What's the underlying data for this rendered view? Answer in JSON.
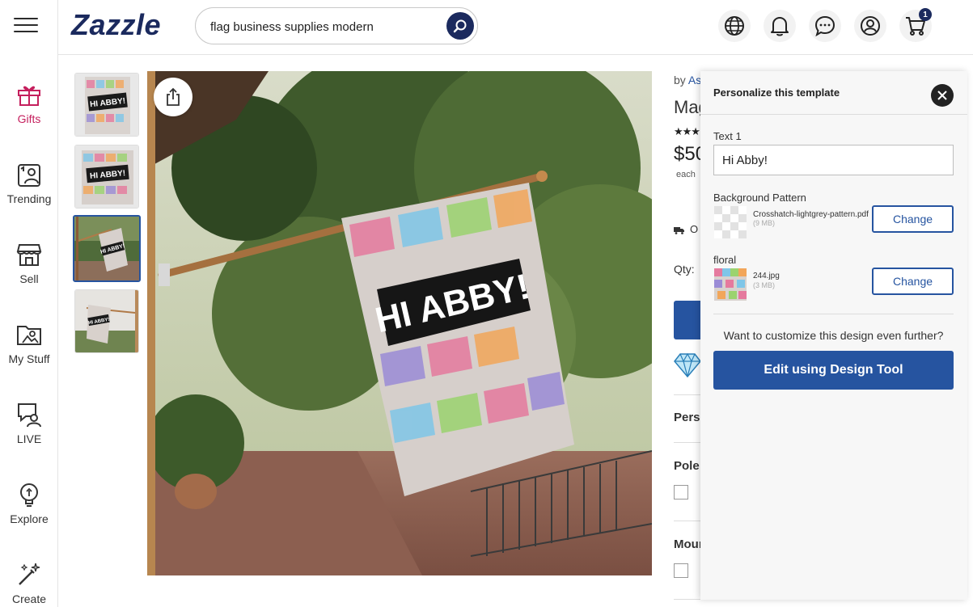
{
  "header": {
    "logo": "Zazzle",
    "search": {
      "value": "flag business supplies modern",
      "placeholder": ""
    },
    "cart_count": "1"
  },
  "rail": {
    "items": [
      {
        "label": "Gifts",
        "icon": "gift-icon",
        "active": true
      },
      {
        "label": "Trending",
        "icon": "trending-icon"
      },
      {
        "label": "Sell",
        "icon": "store-icon"
      },
      {
        "label": "My Stuff",
        "icon": "folder-icon"
      },
      {
        "label": "LIVE",
        "icon": "live-chat-icon"
      },
      {
        "label": "Explore",
        "icon": "lightbulb-icon"
      },
      {
        "label": "Create",
        "icon": "magic-wand-icon"
      }
    ]
  },
  "product": {
    "by": "by",
    "designer_partial": "As",
    "title_partial": "Mag",
    "stars": "★★★",
    "price_partial": "$50",
    "each": "each",
    "shipping_partial": "O",
    "qty_label": "Qty:",
    "sections": [
      "Perso",
      "Pole",
      "Mour"
    ],
    "flag_text": "HI ABBY!"
  },
  "panel": {
    "title": "Personalize this template",
    "text1_label": "Text 1",
    "text1_value": "Hi Abby!",
    "bg_label": "Background Pattern",
    "bg_file": "Crosshatch-lightgrey-pattern.pdf",
    "bg_size": "(9 MB)",
    "floral_label": "floral",
    "floral_file": "244.jpg",
    "floral_size": "(3 MB)",
    "change_label": "Change",
    "customize_note": "Want to customize this design even further?",
    "design_tool_label": "Edit using Design Tool"
  },
  "colors": {
    "brand_navy": "#1b2a5e",
    "accent_blue": "#2654a0",
    "gifts_pink": "#c51f5d"
  }
}
